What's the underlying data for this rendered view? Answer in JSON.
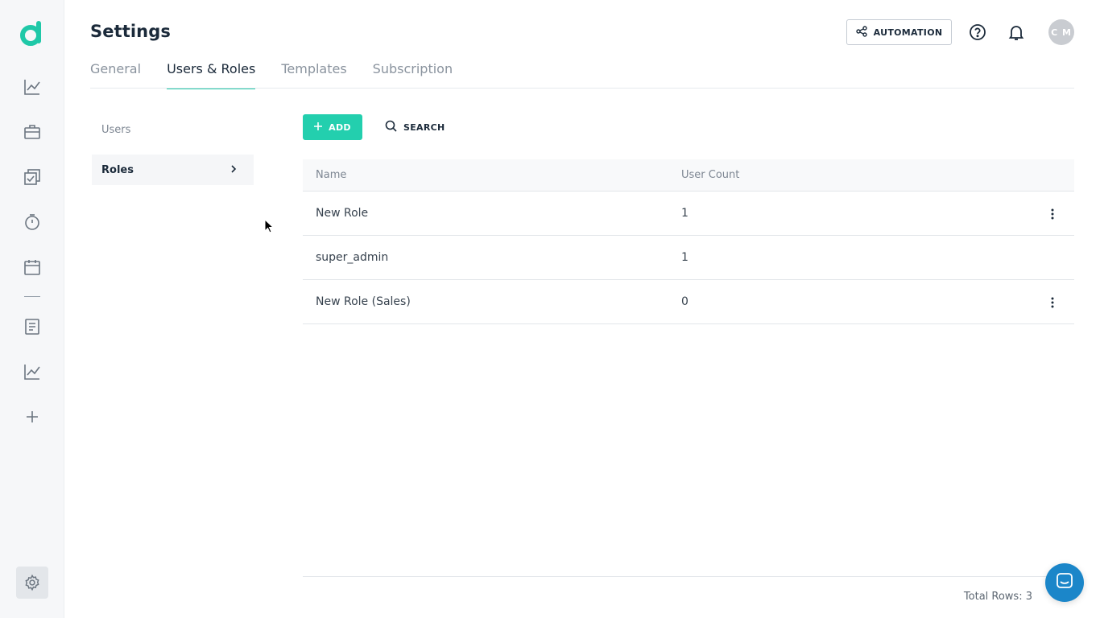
{
  "header": {
    "title": "Settings",
    "automation_label": "AUTOMATION",
    "avatar_initials": "C M"
  },
  "tabs": [
    {
      "label": "General",
      "active": false
    },
    {
      "label": "Users & Roles",
      "active": true
    },
    {
      "label": "Templates",
      "active": false
    },
    {
      "label": "Subscription",
      "active": false
    }
  ],
  "subnav": {
    "users_label": "Users",
    "roles_label": "Roles"
  },
  "toolbar": {
    "add_label": "ADD",
    "search_label": "SEARCH"
  },
  "table": {
    "columns": [
      "Name",
      "User Count"
    ],
    "rows": [
      {
        "name": "New Role",
        "count": "1"
      },
      {
        "name": "super_admin",
        "count": "1"
      },
      {
        "name": "New Role (Sales)",
        "count": "0"
      }
    ]
  },
  "footer": {
    "total_rows": "Total Rows: 3"
  },
  "colors": {
    "accent": "#23cfae",
    "rail_bg": "#f6f7f9",
    "chat": "#1b86c9"
  },
  "rail_icons": [
    "logo-icon",
    "analytics-icon",
    "briefcase-icon",
    "tasks-icon",
    "timer-icon",
    "calendar-icon",
    "document-icon",
    "reports-icon",
    "plus-icon",
    "settings-icon"
  ]
}
